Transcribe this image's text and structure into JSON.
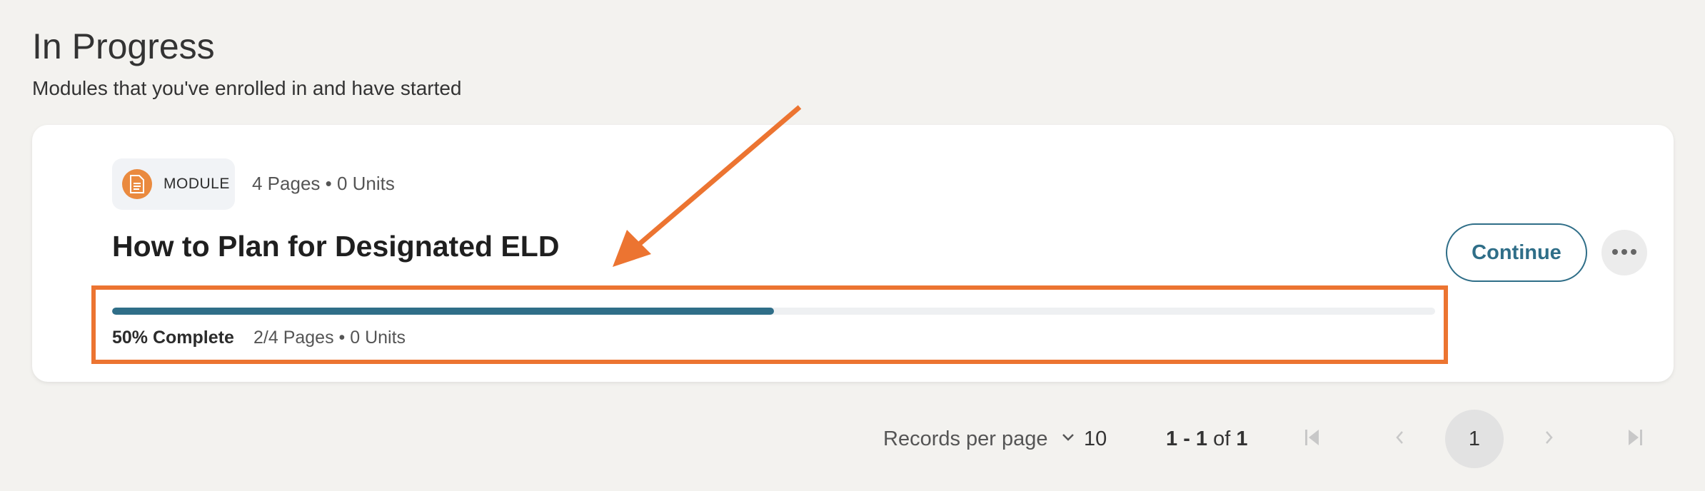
{
  "section": {
    "title": "In Progress",
    "subtitle": "Modules that you've enrolled in and have started"
  },
  "module": {
    "badge_label": "MODULE",
    "meta": "4 Pages • 0 Units",
    "title": "How to Plan for Designated ELD",
    "progress_percent": 50,
    "progress_label": "50% Complete",
    "progress_detail": "2/4 Pages • 0 Units",
    "continue_label": "Continue",
    "icon": "document-icon",
    "more_icon": "more-horizontal-icon"
  },
  "pagination": {
    "records_per_page_label": "Records per page",
    "records_per_page_value": "10",
    "range_start": "1",
    "range_sep": " - ",
    "range_end": "1",
    "range_of": " of ",
    "range_total": "1",
    "current_page": "1"
  },
  "colors": {
    "accent": "#2f6e88",
    "annotation": "#ec7431",
    "module_icon": "#ea8a3f",
    "background": "#f3f2ef"
  }
}
